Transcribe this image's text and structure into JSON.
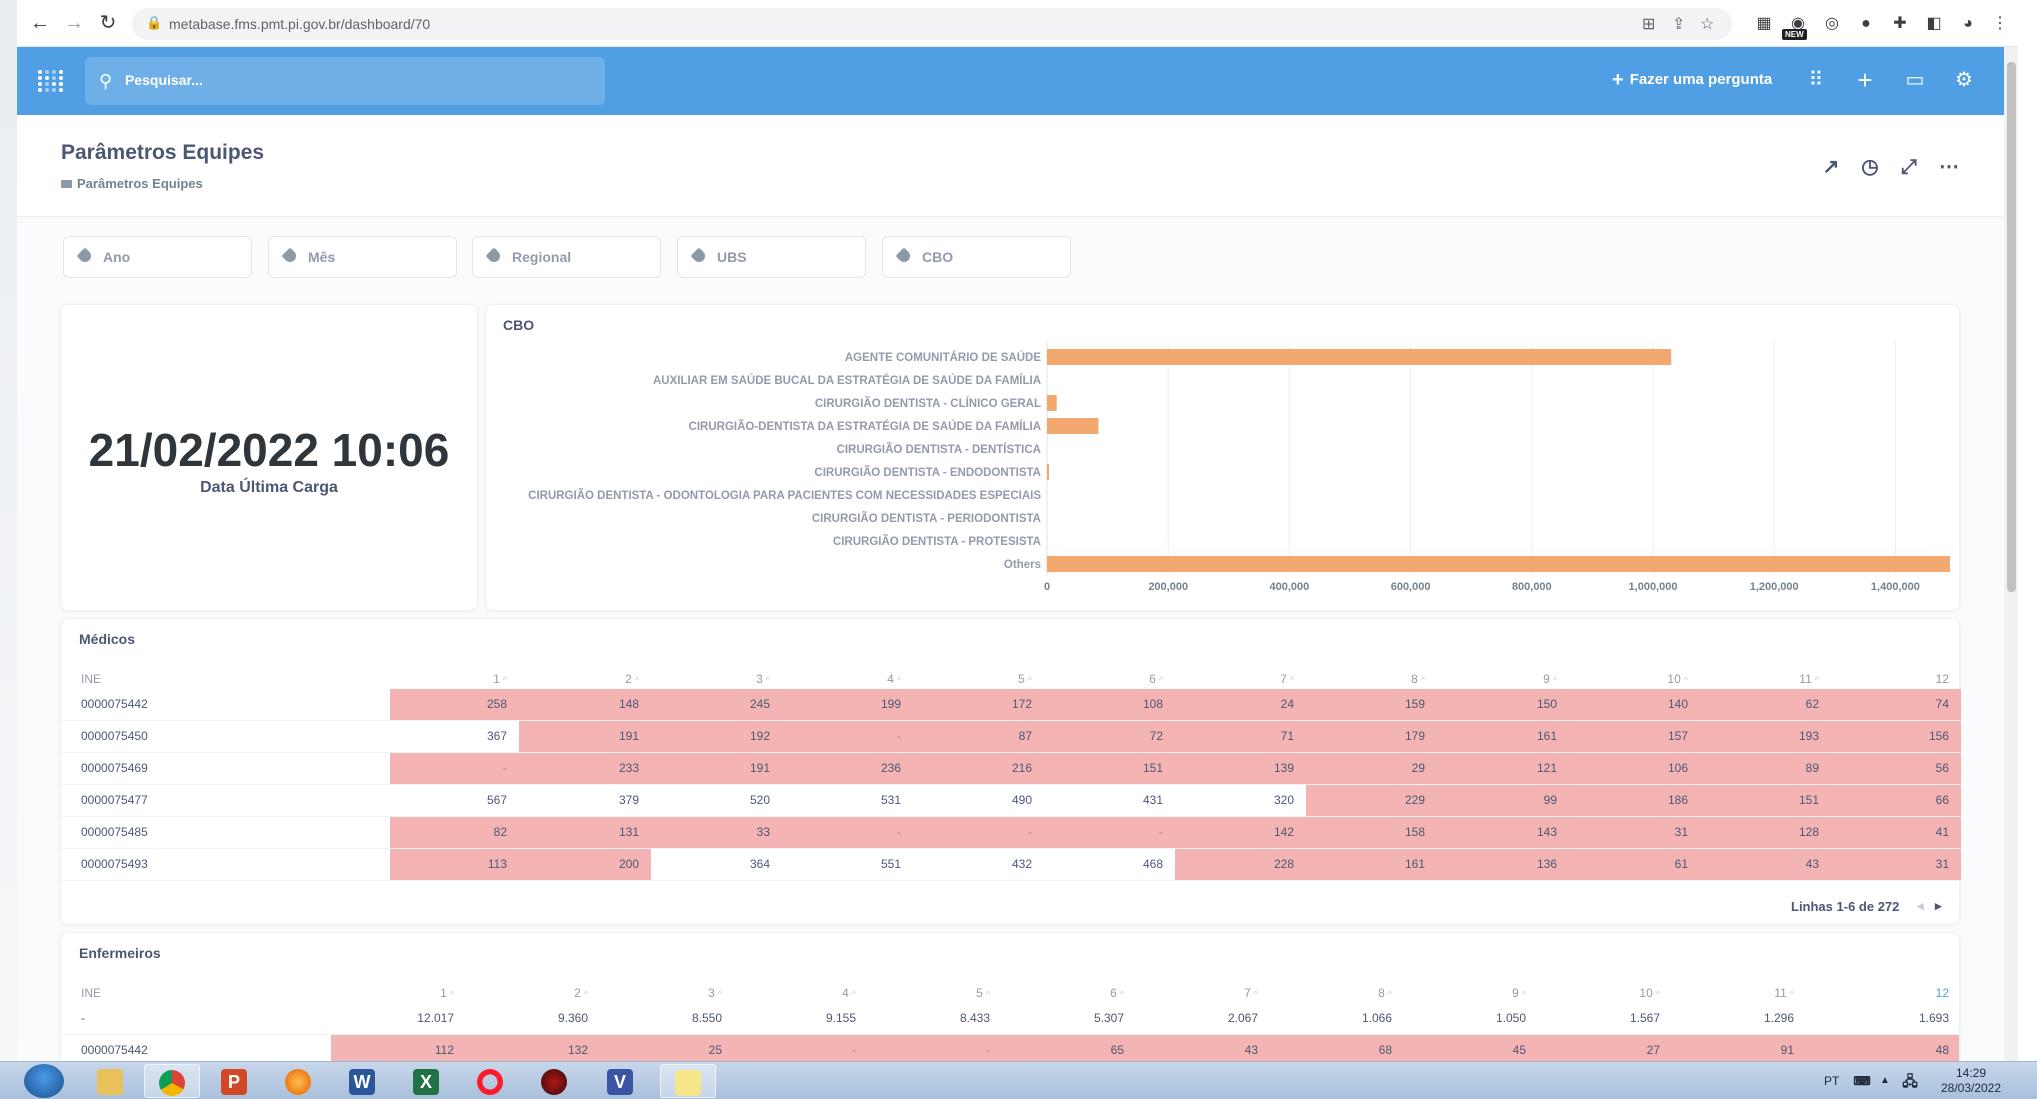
{
  "browser": {
    "url": "metabase.fms.pmt.pi.gov.br/dashboard/70",
    "new_badge": "NEW"
  },
  "nav": {
    "search_placeholder": "Pesquisar...",
    "ask_label": "Fazer uma pergunta"
  },
  "dashboard": {
    "title": "Parâmetros Equipes",
    "collection": "Parâmetros Equipes"
  },
  "filters": [
    "Ano",
    "Mês",
    "Regional",
    "UBS",
    "CBO"
  ],
  "scalar": {
    "value": "21/02/2022 10:06",
    "label": "Data Última Carga"
  },
  "colors": {
    "brand": "#509ee3",
    "bar": "#f2a86f",
    "heat": "#f5b4b4"
  },
  "chart_data": {
    "type": "bar",
    "orientation": "horizontal",
    "title": "CBO",
    "categories": [
      "AGENTE COMUNITÁRIO DE SAÚDE",
      "AUXILIAR EM SAÚDE BUCAL DA ESTRATÉGIA DE SAÚDE DA FAMÍLIA",
      "CIRURGIÃO DENTISTA - CLÍNICO GERAL",
      "CIRURGIÃO-DENTISTA DA ESTRATÉGIA DE SAÚDE DA FAMÍLIA",
      "CIRURGIÃO DENTISTA - DENTÍSTICA",
      "CIRURGIÃO DENTISTA - ENDODONTISTA",
      "CIRURGIÃO DENTISTA - ODONTOLOGIA PARA PACIENTES COM NECESSIDADES ESPECIAIS",
      "CIRURGIÃO DENTISTA - PERIODONTISTA",
      "CIRURGIÃO DENTISTA - PROTESISTA",
      "Others"
    ],
    "values": [
      1030000,
      0,
      16000,
      85000,
      0,
      3000,
      0,
      0,
      0,
      1490000
    ],
    "xlim": [
      0,
      1500000
    ],
    "xticks": [
      0,
      200000,
      400000,
      600000,
      800000,
      1000000,
      1200000,
      1400000
    ],
    "xtick_labels": [
      "0",
      "200,000",
      "400,000",
      "600,000",
      "800,000",
      "1,000,000",
      "1,200,000",
      "1,400,000"
    ],
    "grid": true
  },
  "medicos": {
    "title": "Médicos",
    "columns": [
      "INE",
      "1",
      "2",
      "3",
      "4",
      "5",
      "6",
      "7",
      "8",
      "9",
      "10",
      "11",
      "12"
    ],
    "rows": [
      {
        "cells": [
          "0000075442",
          "258",
          "148",
          "245",
          "199",
          "172",
          "108",
          "24",
          "159",
          "150",
          "140",
          "62",
          "74"
        ],
        "heat": [
          1,
          1,
          1,
          1,
          1,
          1,
          1,
          1,
          1,
          1,
          1,
          1
        ]
      },
      {
        "cells": [
          "0000075450",
          "367",
          "191",
          "192",
          "-",
          "87",
          "72",
          "71",
          "179",
          "161",
          "157",
          "193",
          "156"
        ],
        "heat": [
          0,
          1,
          1,
          1,
          1,
          1,
          1,
          1,
          1,
          1,
          1,
          1
        ]
      },
      {
        "cells": [
          "0000075469",
          "-",
          "233",
          "191",
          "236",
          "216",
          "151",
          "139",
          "29",
          "121",
          "106",
          "89",
          "56"
        ],
        "heat": [
          1,
          1,
          1,
          1,
          1,
          1,
          1,
          1,
          1,
          1,
          1,
          1
        ]
      },
      {
        "cells": [
          "0000075477",
          "567",
          "379",
          "520",
          "531",
          "490",
          "431",
          "320",
          "229",
          "99",
          "186",
          "151",
          "66"
        ],
        "heat": [
          0,
          0,
          0,
          0,
          0,
          0,
          0,
          1,
          1,
          1,
          1,
          1
        ]
      },
      {
        "cells": [
          "0000075485",
          "82",
          "131",
          "33",
          "-",
          "-",
          "-",
          "142",
          "158",
          "143",
          "31",
          "128",
          "41"
        ],
        "heat": [
          1,
          1,
          1,
          1,
          1,
          1,
          1,
          1,
          1,
          1,
          1,
          1
        ]
      },
      {
        "cells": [
          "0000075493",
          "113",
          "200",
          "364",
          "551",
          "432",
          "468",
          "228",
          "161",
          "136",
          "61",
          "43",
          "31"
        ],
        "heat": [
          1,
          1,
          0,
          0,
          0,
          0,
          1,
          1,
          1,
          1,
          1,
          1
        ]
      }
    ],
    "pagination": "Linhas 1-6 de 272"
  },
  "enfermeiros": {
    "title": "Enfermeiros",
    "columns": [
      "INE",
      "1",
      "2",
      "3",
      "4",
      "5",
      "6",
      "7",
      "8",
      "9",
      "10",
      "11",
      "12"
    ],
    "rows": [
      {
        "cells": [
          "-",
          "12.017",
          "9.360",
          "8.550",
          "9.155",
          "8.433",
          "5.307",
          "2.067",
          "1.066",
          "1.050",
          "1.567",
          "1.296",
          "1.693"
        ],
        "heat": [
          0,
          0,
          0,
          0,
          0,
          0,
          0,
          0,
          0,
          0,
          0,
          0
        ]
      },
      {
        "cells": [
          "0000075442",
          "112",
          "132",
          "25",
          "-",
          "-",
          "65",
          "43",
          "68",
          "45",
          "27",
          "91",
          "48"
        ],
        "heat": [
          1,
          1,
          1,
          1,
          1,
          1,
          1,
          1,
          1,
          1,
          1,
          1
        ]
      }
    ]
  },
  "taskbar": {
    "lang": "PT",
    "time": "14:29",
    "date": "28/03/2022"
  }
}
